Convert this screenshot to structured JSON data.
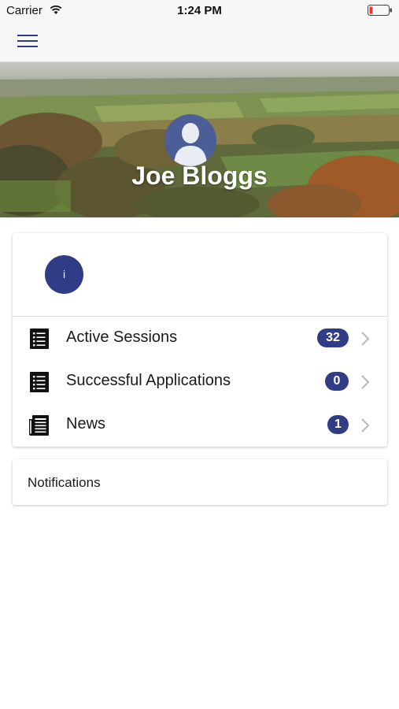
{
  "status_bar": {
    "carrier": "Carrier",
    "time": "1:24 PM",
    "battery_color": "#e53935"
  },
  "nav": {
    "menu_icon": "hamburger-menu-icon",
    "accent_color": "#2f3b87"
  },
  "profile": {
    "name": "Joe Bloggs",
    "avatar_icon": "user-silhouette-icon",
    "avatar_color": "#4c5e98"
  },
  "info_button": {
    "label": "i",
    "color": "#303c86"
  },
  "menu_items": [
    {
      "label": "Active Sessions",
      "count": "32",
      "icon": "list-icon"
    },
    {
      "label": "Successful Applications",
      "count": "0",
      "icon": "list-icon"
    },
    {
      "label": "News",
      "count": "1",
      "icon": "newspaper-icon"
    }
  ],
  "notifications": {
    "title": "Notifications"
  }
}
